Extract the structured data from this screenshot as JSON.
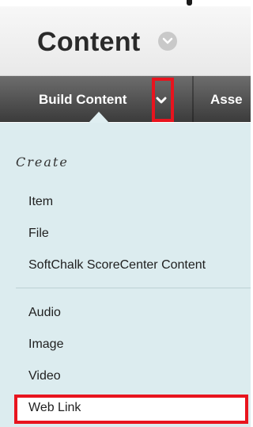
{
  "header": {
    "title": "Content"
  },
  "toolbar": {
    "build_content_label": "Build Content",
    "second_label": "Asse"
  },
  "menu": {
    "section_heading": "Create",
    "group1": [
      "Item",
      "File",
      "SoftChalk ScoreCenter Content"
    ],
    "group2": [
      "Audio",
      "Image",
      "Video",
      "Web Link"
    ]
  },
  "colors": {
    "highlight": "#e8141e",
    "menu_background": "#dcecef",
    "toolbar_dark": "#3b3b3b"
  }
}
